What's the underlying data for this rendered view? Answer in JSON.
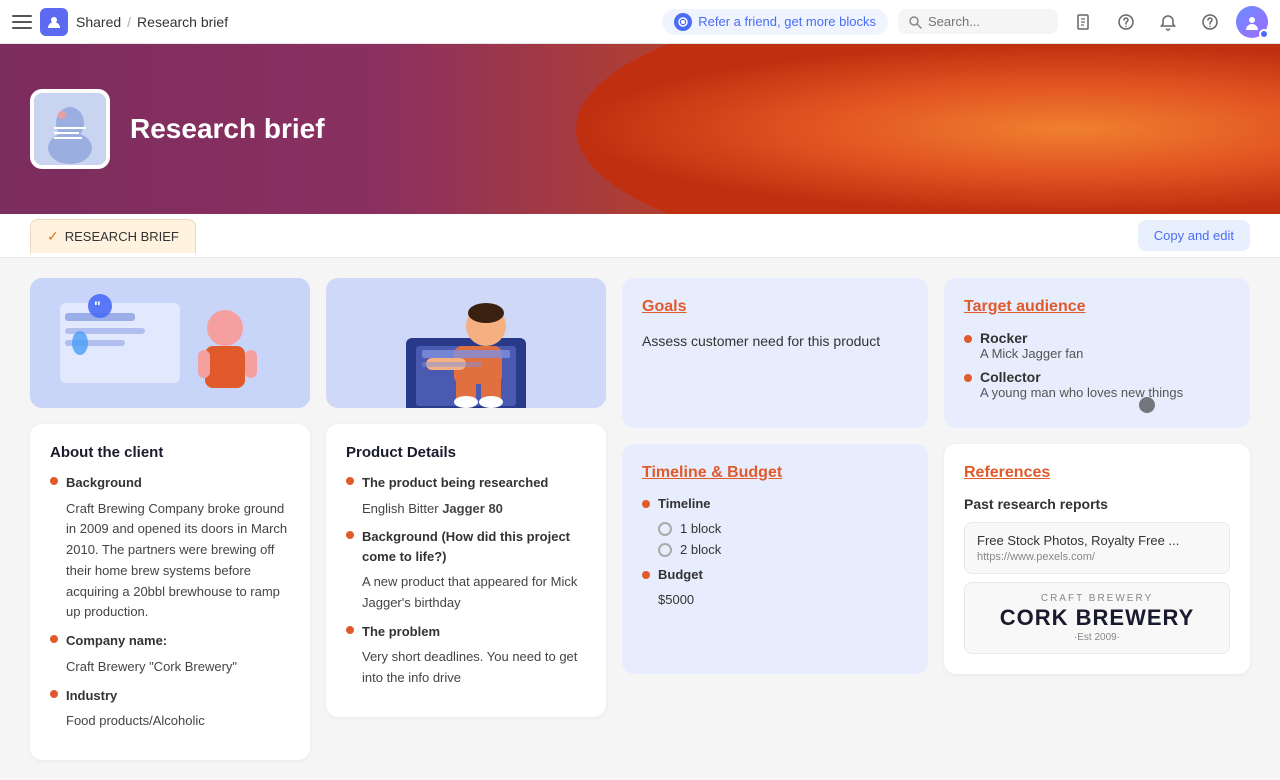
{
  "topnav": {
    "workspace_label": "Shared",
    "breadcrumb_sep": "/",
    "page_name": "Research brief",
    "refer_text": "Refer a friend, get more blocks",
    "search_placeholder": "Search...",
    "icons": [
      "doc-icon",
      "help-icon",
      "bell-icon",
      "question-icon"
    ]
  },
  "header": {
    "title": "Research brief",
    "tab_label": "RESEARCH BRIEF",
    "copy_edit_label": "Copy and edit"
  },
  "about_client": {
    "title": "About the client",
    "sections": [
      {
        "label": "Background",
        "text": "Craft Brewing Company broke ground in 2009 and opened its doors in March 2010. The partners were brewing off their home brew systems before acquiring a 20bbl brewhouse to ramp up production."
      },
      {
        "label": "Company name:",
        "text": "Craft Brewery \"Cork Brewery\""
      },
      {
        "label": "Industry",
        "text": "Food products/Alcoholic"
      }
    ]
  },
  "product_details": {
    "title": "Product Details",
    "sections": [
      {
        "label": "The product being researched",
        "text": "English Bitter Jagger 80"
      },
      {
        "label": "Background (How did this project come to life?)",
        "text": "A new product that appeared for Mick Jagger's birthday"
      },
      {
        "label": "The problem",
        "text": "Very short deadlines. You need to get into the info drive"
      }
    ]
  },
  "goals": {
    "title": "Goals",
    "text": "Assess customer need for this product"
  },
  "target_audience": {
    "title": "Target audience",
    "items": [
      {
        "main": "Rocker",
        "sub": "A Mick Jagger fan"
      },
      {
        "main": "Collector",
        "sub": "A young man who loves new things"
      }
    ]
  },
  "timeline_budget": {
    "title": "Timeline & Budget",
    "timeline_label": "Timeline",
    "options": [
      "1 block",
      "2 block"
    ],
    "budget_label": "Budget",
    "budget_amount": "$5000"
  },
  "references": {
    "title": "References",
    "past_reports_title": "Past research reports",
    "items": [
      {
        "title": "Free Stock Photos, Royalty Free ...",
        "url": "https://www.pexels.com/"
      }
    ],
    "cork_brewery": {
      "sub": "CRAFT BREWERY",
      "name": "CORK BREWERY",
      "est": "·Est 2009·"
    }
  }
}
